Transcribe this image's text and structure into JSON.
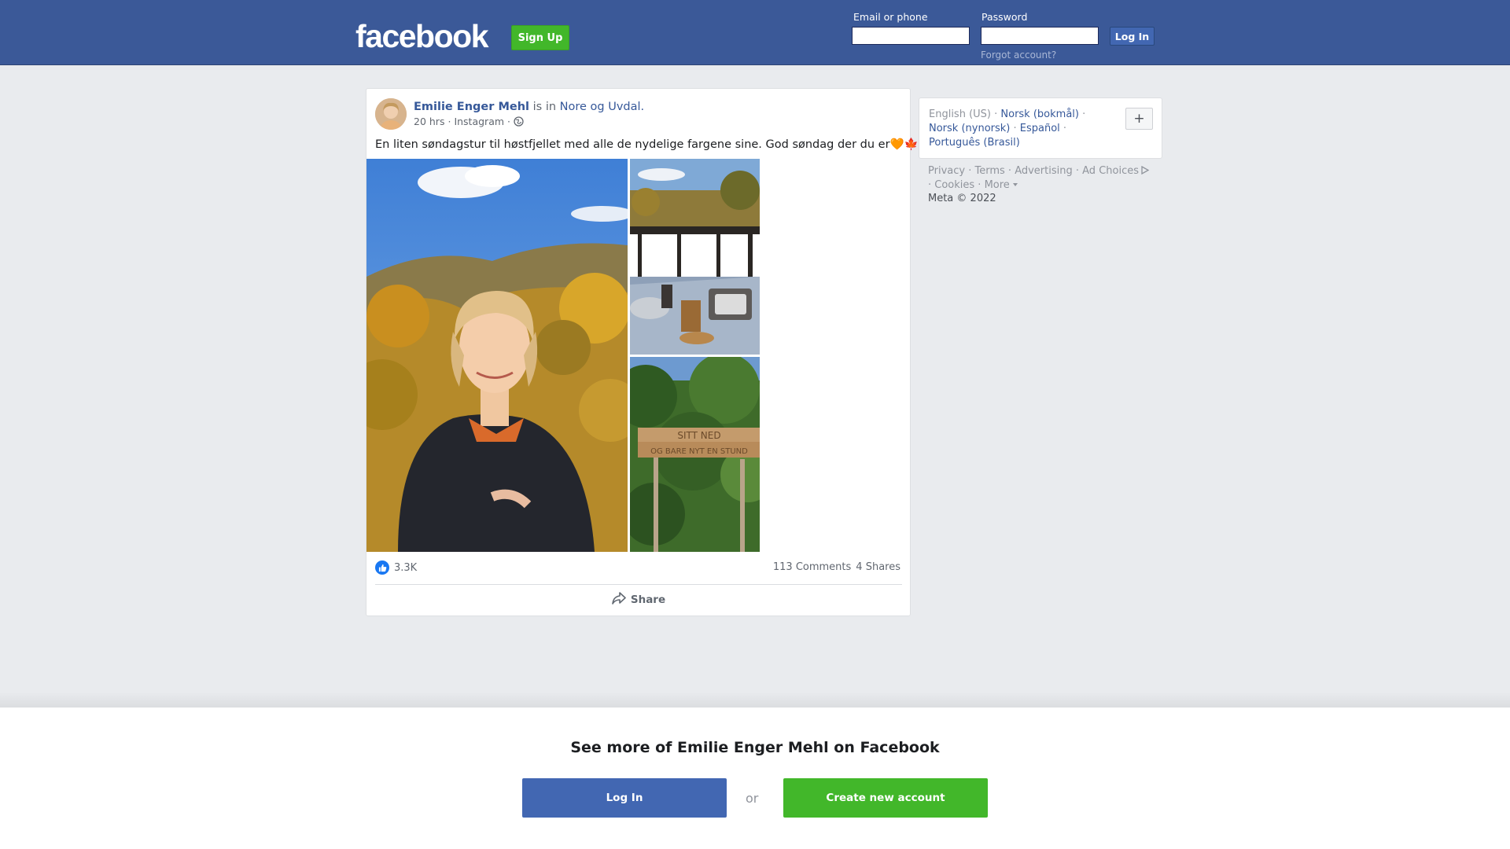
{
  "header": {
    "logo_text": "facebook",
    "signup_label": "Sign Up",
    "email_label": "Email or phone",
    "password_label": "Password",
    "email_value": "",
    "password_value": "",
    "login_label": "Log In",
    "forgot_label": "Forgot account?"
  },
  "post": {
    "author": "Emilie Enger Mehl",
    "is_in": "is in",
    "place": "Nore og Uvdal.",
    "time": "20 hrs",
    "separator": "·",
    "source": "Instagram",
    "privacy_icon": "globe-icon",
    "text": "En liten søndagstur til høstfjellet med alle de nydelige fargene sine. God søndag der du er🧡🍁",
    "photos": [
      {
        "name": "photo-woman-autumn",
        "icon": "photo"
      },
      {
        "name": "photo-table-terrace",
        "icon": "photo"
      },
      {
        "name": "photo-wooden-sign",
        "icon": "photo"
      }
    ],
    "sign_text": [
      "SITT NED",
      "OG BARE NYT EN STUND"
    ],
    "reaction_icon": "like-icon",
    "reaction_count": "3.3K",
    "comments": "113 Comments",
    "shares": "4 Shares",
    "share_icon": "share-arrow-icon",
    "share_label": "Share"
  },
  "languages": {
    "items": [
      {
        "label": "English (US)",
        "current": true
      },
      {
        "label": "Norsk (bokmål)",
        "current": false
      },
      {
        "label": "Norsk (nynorsk)",
        "current": false
      },
      {
        "label": "Español",
        "current": false
      },
      {
        "label": "Português (Brasil)",
        "current": false
      }
    ],
    "more_icon": "plus-icon",
    "more_label": "+"
  },
  "footer": {
    "privacy": "Privacy",
    "terms": "Terms",
    "advertising": "Advertising",
    "ad_choices": "Ad Choices",
    "cookies": "Cookies",
    "more": "More",
    "copyright": "Meta © 2022"
  },
  "banner": {
    "title": "See more of Emilie Enger Mehl on Facebook",
    "login_label": "Log In",
    "or_label": "or",
    "create_label": "Create new account"
  },
  "colors": {
    "brand_blue": "#3b5998",
    "button_blue": "#4267b2",
    "green": "#42b72a",
    "link": "#365899",
    "background": "#e9ebee"
  }
}
